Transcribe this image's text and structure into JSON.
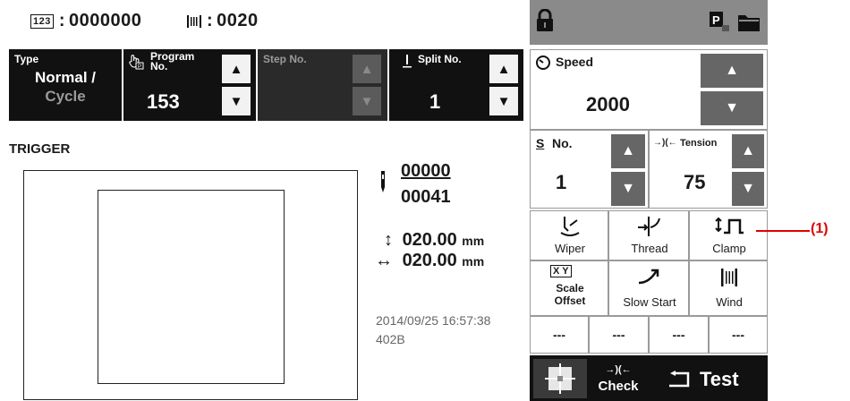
{
  "status": {
    "stitch_counter": "0000000",
    "bobbin_counter": "0020",
    "stitch_counter_prefix": "123",
    "separator": ":"
  },
  "header": {
    "type_label": "Type",
    "type_value_line1": "Normal /",
    "type_value_line2": "Cycle",
    "program_label_line1": "Program",
    "program_label_line2": "No.",
    "program_value": "153",
    "step_label": "Step No.",
    "split_label": "Split No.",
    "split_value": "1"
  },
  "main": {
    "section_title": "TRIGGER",
    "stitch_count_top": "00000",
    "stitch_count_bottom": "00041",
    "size_y": "020.00",
    "size_x": "020.00",
    "unit": "mm",
    "timestamp": "2014/09/25 16:57:38",
    "code": "402B"
  },
  "right": {
    "speed_label": "Speed",
    "speed_value": "2000",
    "s_no_label": "No.",
    "s_no_prefix": "S",
    "s_no_value": "1",
    "tension_label": "Tension",
    "tension_value": "75",
    "wiper_label": "Wiper",
    "thread_label": "Thread",
    "clamp_label": "Clamp",
    "scale_offset_line1": "Scale",
    "scale_offset_line2": "Offset",
    "slow_start_label": "Slow Start",
    "wind_label": "Wind",
    "dash_1": "---",
    "dash_2": "---",
    "dash_3": "---",
    "dash_4": "---",
    "check_label": "Check",
    "test_label": "Test",
    "xy_label": "X Y"
  },
  "annotation": {
    "callout_1": "(1)"
  }
}
